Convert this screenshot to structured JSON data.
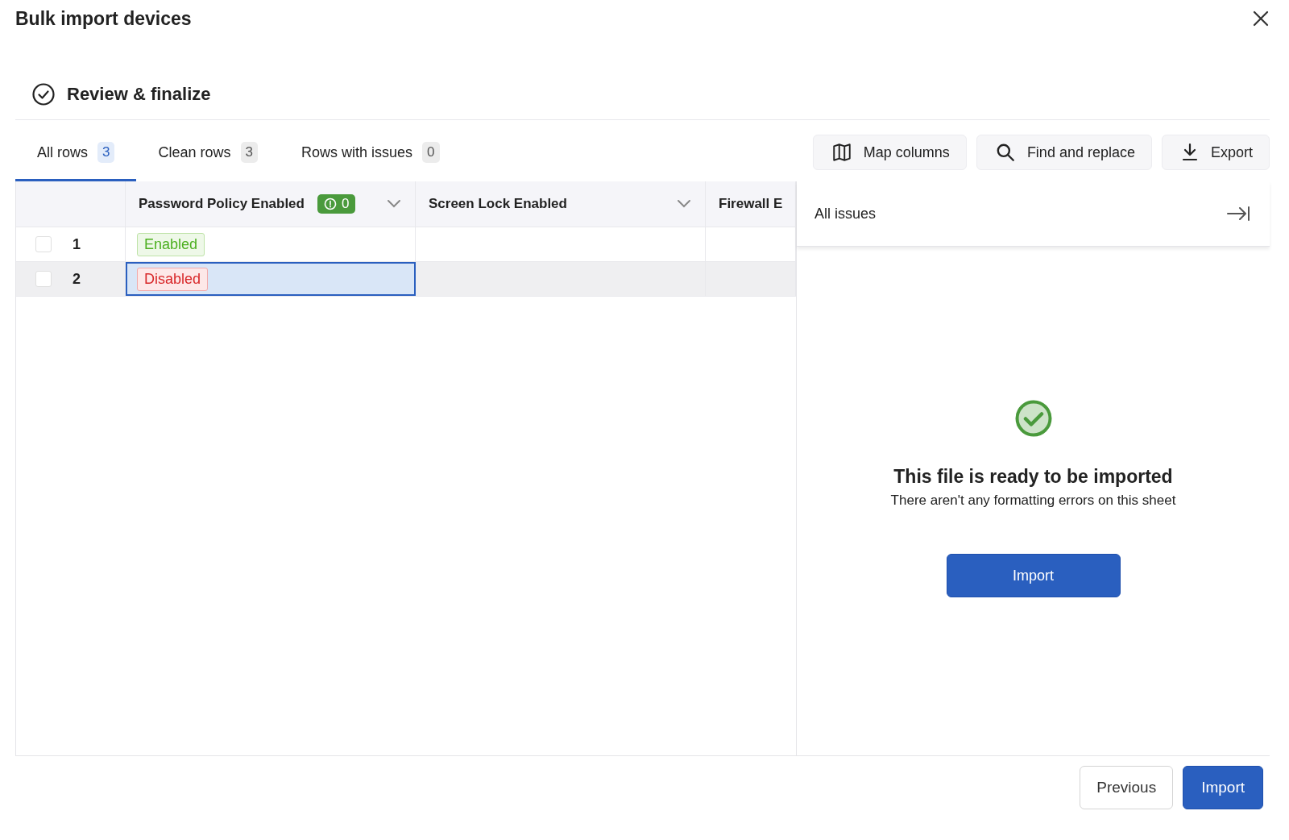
{
  "dialog": {
    "title": "Bulk import devices",
    "step": "Review & finalize"
  },
  "tabs": [
    {
      "label": "All rows",
      "count": "3",
      "selected": true
    },
    {
      "label": "Clean rows",
      "count": "3",
      "selected": false
    },
    {
      "label": "Rows with issues",
      "count": "0",
      "selected": false
    }
  ],
  "toolbar": [
    {
      "label": "Map columns",
      "kind": "map"
    },
    {
      "label": "Find and replace",
      "kind": "search"
    },
    {
      "label": "Export",
      "kind": "export"
    }
  ],
  "table": {
    "columns": [
      {
        "name": "Password Policy Enabled",
        "issues": "0"
      },
      {
        "name": "Screen Lock Enabled"
      },
      {
        "name": "Firewall E"
      }
    ],
    "rows": [
      {
        "number": "1",
        "checked": false,
        "hovered": false,
        "cells": [
          {
            "value": "Enabled",
            "kind": "success",
            "selected": false
          }
        ]
      },
      {
        "number": "2",
        "checked": false,
        "hovered": true,
        "cells": [
          {
            "value": "Disabled",
            "kind": "error",
            "selected": true
          }
        ]
      }
    ]
  },
  "issues_panel": {
    "title": "All issues",
    "heading": "This file is ready to be imported",
    "message": "There aren't any formatting errors on this sheet",
    "button": "Import"
  },
  "footer": {
    "buttons": [
      {
        "label": "Previous",
        "kind": "secondary"
      },
      {
        "label": "Import",
        "kind": "primary"
      }
    ]
  }
}
